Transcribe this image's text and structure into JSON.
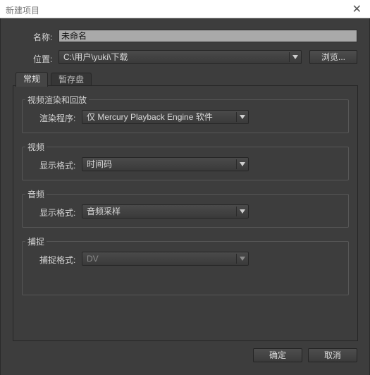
{
  "window": {
    "title": "新建项目",
    "close_glyph": "✕"
  },
  "name": {
    "label": "名称:",
    "value": "未命名"
  },
  "location": {
    "label": "位置:",
    "value": "C:\\用户\\yuki\\下载",
    "browse_label": "浏览..."
  },
  "tabs": [
    {
      "label": "常规",
      "active": true
    },
    {
      "label": "暂存盘",
      "active": false
    }
  ],
  "groups": {
    "render": {
      "title": "视频渲染和回放",
      "label": "渲染程序:",
      "value": "仅 Mercury Playback Engine 软件"
    },
    "video": {
      "title": "视频",
      "label": "显示格式:",
      "value": "时间码"
    },
    "audio": {
      "title": "音频",
      "label": "显示格式:",
      "value": "音频采样"
    },
    "capture": {
      "title": "捕捉",
      "label": "捕捉格式:",
      "value": "DV",
      "disabled": true
    }
  },
  "footer": {
    "ok_label": "确定",
    "cancel_label": "取消"
  },
  "colors": {
    "background": "#3d3d3d",
    "input_fill": "#a9a9a9"
  }
}
